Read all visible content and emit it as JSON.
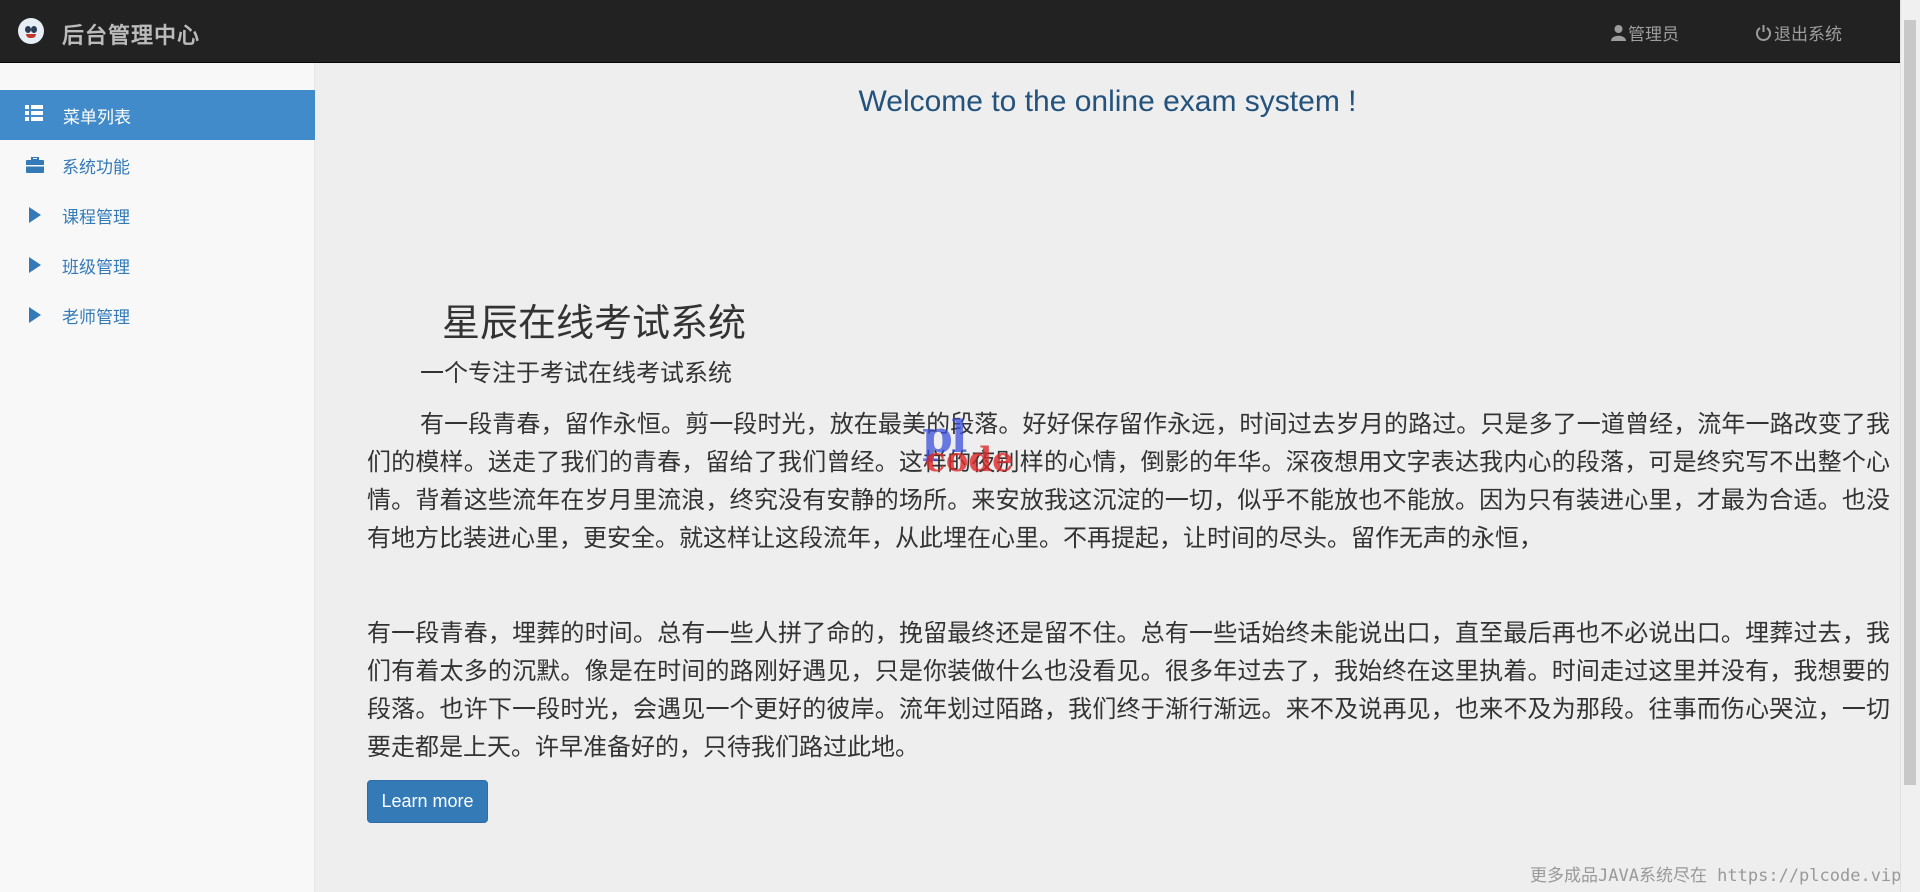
{
  "header": {
    "brand_title": "后台管理中心",
    "user_label": "管理员",
    "logout_label": "退出系统"
  },
  "sidebar": {
    "menu_header": "菜单列表",
    "items": [
      {
        "label": "系统功能",
        "icon": "briefcase-icon"
      },
      {
        "label": "课程管理",
        "icon": "play-triangle-icon"
      },
      {
        "label": "班级管理",
        "icon": "play-triangle-icon"
      },
      {
        "label": "老师管理",
        "icon": "play-triangle-icon"
      }
    ]
  },
  "main": {
    "welcome": "Welcome to the online exam system !",
    "title": "星辰在线考试系统",
    "subtitle": "一个专注于考试在线考试系统",
    "paragraphs": [
      "有一段青春，留作永恒。剪一段时光，放在最美的段落。好好保存留作永远，时间过去岁月的路过。只是多了一道曾经，流年一路改变了我们的模样。送走了我们的青春，留给了我们曾经。这样的夜别样的心情，倒影的年华。深夜想用文字表达我内心的段落，可是终究写不出整个心情。背着这些流年在岁月里流浪，终究没有安静的场所。来安放我这沉淀的一切，似乎不能放也不能放。因为只有装进心里，才最为合适。也没有地方比装进心里，更安全。就这样让这段流年，从此埋在心里。不再提起，让时间的尽头。留作无声的永恒，",
      "有一段青春，埋葬的时间。总有一些人拼了命的，挽留最终还是留不住。总有一些话始终未能说出口，直至最后再也不必说出口。埋葬过去，我们有着太多的沉默。像是在时间的路刚好遇见，只是你装做什么也没看见。很多年过去了，我始终在这里执着。时间走过这里并没有，我想要的段落。也许下一段时光，会遇见一个更好的彼岸。流年划过陌路，我们终于渐行渐远。来不及说再见，也来不及为那段。往事而伤心哭泣，一切要走都是上天。许早准备好的，只待我们路过此地。"
    ],
    "learn_more": "Learn more"
  },
  "watermark": {
    "logo_top": "pl",
    "logo_bottom": "code",
    "footer": "更多成品JAVA系统尽在 https://plcode.vip"
  },
  "colors": {
    "navbar_bg": "#222222",
    "primary": "#337ab7",
    "menu_active": "#428bca"
  }
}
